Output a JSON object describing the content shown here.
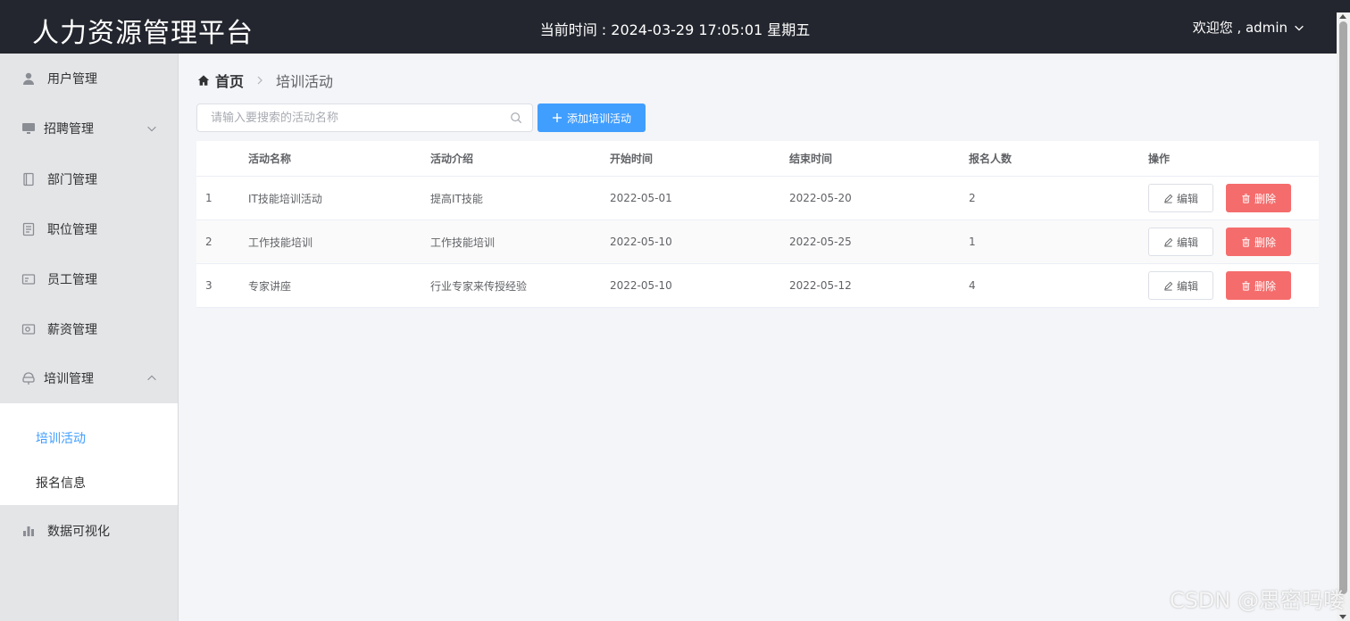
{
  "header": {
    "title": "人力资源管理平台",
    "clock": "当前时间 : 2024-03-29 17:05:01 星期五",
    "user": "欢迎您 , admin"
  },
  "sidebar": {
    "items": [
      {
        "label": "用户管理",
        "icon": "user-icon"
      },
      {
        "label": "招聘管理",
        "icon": "monitor-icon"
      },
      {
        "label": "部门管理",
        "icon": "notebook-icon"
      },
      {
        "label": "职位管理",
        "icon": "document-icon"
      },
      {
        "label": "员工管理",
        "icon": "id-card-icon"
      },
      {
        "label": "薪资管理",
        "icon": "wallet-icon"
      },
      {
        "label": "培训管理",
        "icon": "training-icon"
      },
      {
        "label": "数据可视化",
        "icon": "bar-chart-icon"
      }
    ],
    "submenu": [
      {
        "label": "培训活动",
        "active": true
      },
      {
        "label": "报名信息",
        "active": false
      }
    ]
  },
  "breadcrumb": {
    "home": "首页",
    "current": "培训活动"
  },
  "search": {
    "placeholder": "请输入要搜索的活动名称",
    "value": ""
  },
  "toolbar": {
    "add_label": "添加培训活动"
  },
  "table": {
    "columns": [
      "",
      "活动名称",
      "活动介绍",
      "开始时间",
      "结束时间",
      "报名人数",
      "操作"
    ],
    "rows": [
      {
        "index": "1",
        "name": "IT技能培训活动",
        "intro": "提高IT技能",
        "start": "2022-05-01",
        "end": "2022-05-20",
        "count": "2"
      },
      {
        "index": "2",
        "name": "工作技能培训",
        "intro": "工作技能培训",
        "start": "2022-05-10",
        "end": "2022-05-25",
        "count": "1"
      },
      {
        "index": "3",
        "name": "专家讲座",
        "intro": "行业专家来传授经验",
        "start": "2022-05-10",
        "end": "2022-05-12",
        "count": "4"
      }
    ],
    "edit_label": "编辑",
    "delete_label": "删除"
  },
  "colors": {
    "accent": "#409eff",
    "danger": "#f56c6c",
    "header_bg": "#23262e",
    "sidebar_bg": "#e4e5e7"
  },
  "watermark": "CSDN @思密吗喽"
}
